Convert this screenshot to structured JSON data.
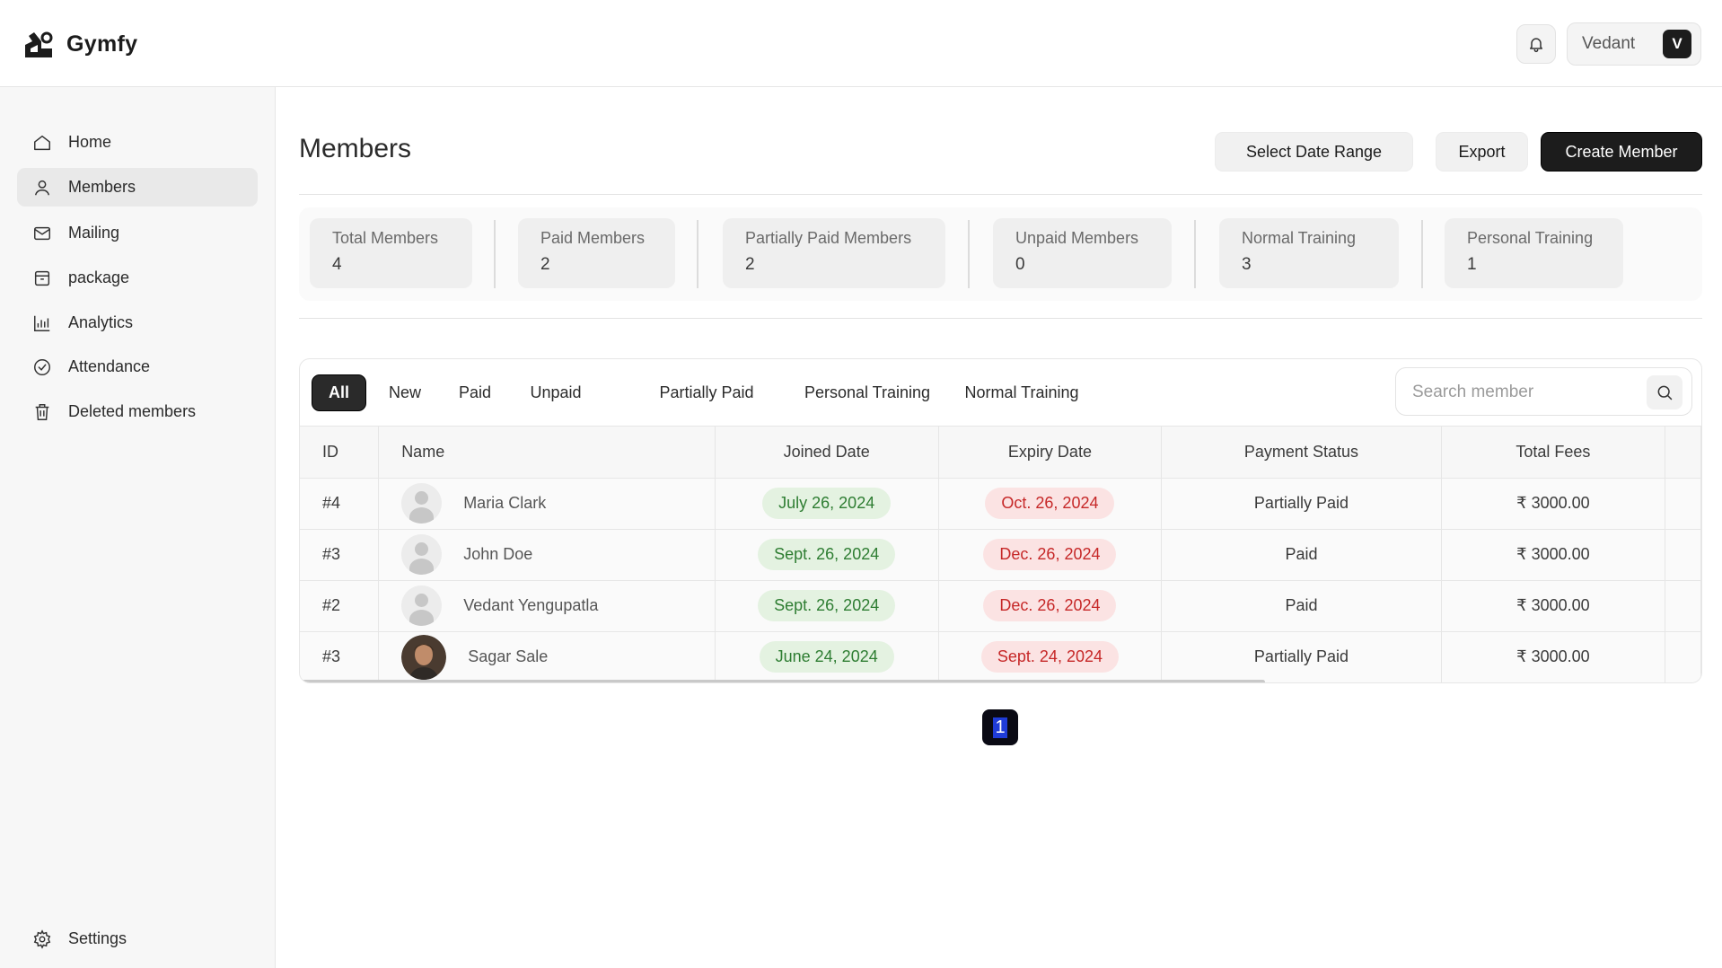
{
  "app": {
    "name": "Gymfy"
  },
  "header": {
    "user_name": "Vedant",
    "user_initial": "V"
  },
  "sidebar": {
    "items": [
      {
        "label": "Home",
        "icon": "home-icon",
        "active": false
      },
      {
        "label": "Members",
        "icon": "user-icon",
        "active": true
      },
      {
        "label": "Mailing",
        "icon": "mail-icon",
        "active": false
      },
      {
        "label": "package",
        "icon": "package-icon",
        "active": false
      },
      {
        "label": "Analytics",
        "icon": "bar-chart-icon",
        "active": false
      },
      {
        "label": "Attendance",
        "icon": "check-circle-icon",
        "active": false
      },
      {
        "label": "Deleted members",
        "icon": "trash-icon",
        "active": false
      }
    ],
    "settings_label": "Settings"
  },
  "page": {
    "title": "Members",
    "actions": {
      "date_range": "Select Date Range",
      "export": "Export",
      "create": "Create Member"
    }
  },
  "stats": [
    {
      "label": "Total Members",
      "value": "4"
    },
    {
      "label": "Paid Members",
      "value": "2"
    },
    {
      "label": "Partially Paid Members",
      "value": "2"
    },
    {
      "label": "Unpaid Members",
      "value": "0"
    },
    {
      "label": "Normal Training",
      "value": "3"
    },
    {
      "label": "Personal Training",
      "value": "1"
    }
  ],
  "filters": {
    "tabs": [
      "All",
      "New",
      "Paid",
      "Unpaid",
      "Partially Paid",
      "Personal Training",
      "Normal Training"
    ],
    "active": "All",
    "search_placeholder": "Search member"
  },
  "table": {
    "columns": [
      "ID",
      "Name",
      "Joined Date",
      "Expiry Date",
      "Payment Status",
      "Total Fees"
    ],
    "rows": [
      {
        "id": "#4",
        "name": "Maria Clark",
        "joined": "July 26, 2024",
        "expiry": "Oct. 26, 2024",
        "status": "Partially Paid",
        "fees": "₹ 3000.00",
        "photo": false
      },
      {
        "id": "#3",
        "name": "John Doe",
        "joined": "Sept. 26, 2024",
        "expiry": "Dec. 26, 2024",
        "status": "Paid",
        "fees": "₹ 3000.00",
        "photo": false
      },
      {
        "id": "#2",
        "name": "Vedant Yengupatla",
        "joined": "Sept. 26, 2024",
        "expiry": "Dec. 26, 2024",
        "status": "Paid",
        "fees": "₹ 3000.00",
        "photo": false
      },
      {
        "id": "#3",
        "name": "Sagar Sale",
        "joined": "June 24, 2024",
        "expiry": "Sept. 24, 2024",
        "status": "Partially Paid",
        "fees": "₹ 3000.00",
        "photo": true
      }
    ]
  },
  "pagination": {
    "current": "1"
  }
}
